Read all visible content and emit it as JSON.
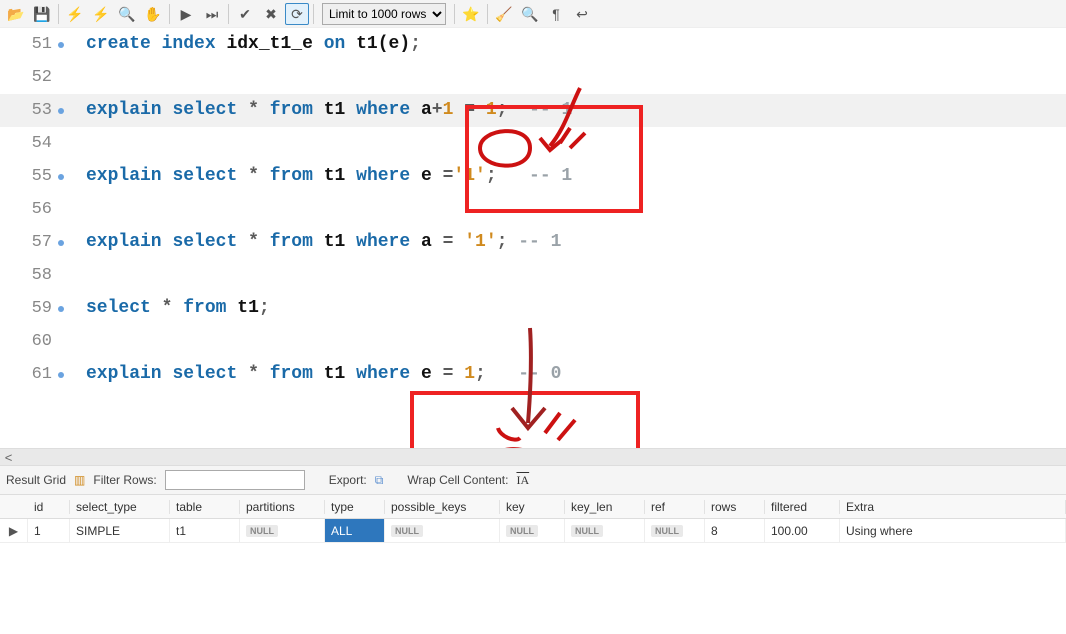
{
  "toolbar": {
    "limit_label": "Limit to 1000 rows",
    "icons": [
      "open-file-icon",
      "save-icon",
      "sep",
      "execute-icon",
      "execute-script-icon",
      "explain-icon",
      "stop-icon",
      "sep",
      "continue-icon",
      "skip-icon",
      "sep",
      "commit-icon",
      "rollback-icon",
      "autocommit-icon",
      "sep",
      "limit",
      "sep",
      "favorite-icon",
      "sep",
      "beautify-icon",
      "search-icon",
      "show-invisible-icon",
      "wrap-icon"
    ]
  },
  "editor": {
    "rows": [
      {
        "n": "51",
        "dot": true,
        "hl": false,
        "tokens": [
          [
            "kw",
            "create"
          ],
          [
            "sp",
            " "
          ],
          [
            "kw",
            "index"
          ],
          [
            "sp",
            " "
          ],
          [
            "id",
            "idx_t1_e"
          ],
          [
            "sp",
            " "
          ],
          [
            "kw",
            "on"
          ],
          [
            "sp",
            " "
          ],
          [
            "id",
            "t1(e)"
          ],
          [
            "op",
            ";"
          ]
        ]
      },
      {
        "n": "52",
        "dot": false,
        "hl": false,
        "tokens": []
      },
      {
        "n": "53",
        "dot": true,
        "hl": true,
        "tokens": [
          [
            "kw",
            "explain"
          ],
          [
            "sp",
            " "
          ],
          [
            "kw",
            "select"
          ],
          [
            "sp",
            " "
          ],
          [
            "op",
            "*"
          ],
          [
            "sp",
            " "
          ],
          [
            "kw",
            "from"
          ],
          [
            "sp",
            " "
          ],
          [
            "id",
            "t1"
          ],
          [
            "sp",
            " "
          ],
          [
            "kw",
            "where"
          ],
          [
            "sp",
            " "
          ],
          [
            "id",
            "a"
          ],
          [
            "op",
            "+"
          ],
          [
            "num",
            "1"
          ],
          [
            "sp",
            " "
          ],
          [
            "op",
            "="
          ],
          [
            "sp",
            " "
          ],
          [
            "num",
            "1"
          ],
          [
            "op",
            ";"
          ],
          [
            "sp",
            "  "
          ],
          [
            "cm",
            "-- 1"
          ]
        ]
      },
      {
        "n": "54",
        "dot": false,
        "hl": false,
        "tokens": []
      },
      {
        "n": "55",
        "dot": true,
        "hl": false,
        "tokens": [
          [
            "kw",
            "explain"
          ],
          [
            "sp",
            " "
          ],
          [
            "kw",
            "select"
          ],
          [
            "sp",
            " "
          ],
          [
            "op",
            "*"
          ],
          [
            "sp",
            " "
          ],
          [
            "kw",
            "from"
          ],
          [
            "sp",
            " "
          ],
          [
            "id",
            "t1"
          ],
          [
            "sp",
            " "
          ],
          [
            "kw",
            "where"
          ],
          [
            "sp",
            " "
          ],
          [
            "id",
            "e"
          ],
          [
            "sp",
            " "
          ],
          [
            "op",
            "="
          ],
          [
            "str",
            "'1'"
          ],
          [
            "op",
            ";"
          ],
          [
            "sp",
            "   "
          ],
          [
            "cm",
            "-- 1"
          ]
        ]
      },
      {
        "n": "56",
        "dot": false,
        "hl": false,
        "tokens": []
      },
      {
        "n": "57",
        "dot": true,
        "hl": false,
        "tokens": [
          [
            "kw",
            "explain"
          ],
          [
            "sp",
            " "
          ],
          [
            "kw",
            "select"
          ],
          [
            "sp",
            " "
          ],
          [
            "op",
            "*"
          ],
          [
            "sp",
            " "
          ],
          [
            "kw",
            "from"
          ],
          [
            "sp",
            " "
          ],
          [
            "id",
            "t1"
          ],
          [
            "sp",
            " "
          ],
          [
            "kw",
            "where"
          ],
          [
            "sp",
            " "
          ],
          [
            "id",
            "a"
          ],
          [
            "sp",
            " "
          ],
          [
            "op",
            "="
          ],
          [
            "sp",
            " "
          ],
          [
            "str",
            "'1'"
          ],
          [
            "op",
            ";"
          ],
          [
            "sp",
            " "
          ],
          [
            "cm",
            "-- 1"
          ]
        ]
      },
      {
        "n": "58",
        "dot": false,
        "hl": false,
        "tokens": []
      },
      {
        "n": "59",
        "dot": true,
        "hl": false,
        "tokens": [
          [
            "kw",
            "select"
          ],
          [
            "sp",
            " "
          ],
          [
            "op",
            "*"
          ],
          [
            "sp",
            " "
          ],
          [
            "kw",
            "from"
          ],
          [
            "sp",
            " "
          ],
          [
            "id",
            "t1"
          ],
          [
            "op",
            ";"
          ]
        ]
      },
      {
        "n": "60",
        "dot": false,
        "hl": false,
        "tokens": []
      },
      {
        "n": "61",
        "dot": true,
        "hl": false,
        "tokens": [
          [
            "kw",
            "explain"
          ],
          [
            "sp",
            " "
          ],
          [
            "kw",
            "select"
          ],
          [
            "sp",
            " "
          ],
          [
            "op",
            "*"
          ],
          [
            "sp",
            " "
          ],
          [
            "kw",
            "from"
          ],
          [
            "sp",
            " "
          ],
          [
            "id",
            "t1"
          ],
          [
            "sp",
            " "
          ],
          [
            "kw",
            "where"
          ],
          [
            "sp",
            " "
          ],
          [
            "id",
            "e"
          ],
          [
            "sp",
            " "
          ],
          [
            "op",
            "="
          ],
          [
            "sp",
            " "
          ],
          [
            "num",
            "1"
          ],
          [
            "op",
            ";"
          ],
          [
            "sp",
            "   "
          ],
          [
            "cm",
            "-- 0"
          ]
        ]
      }
    ]
  },
  "hscroll_left": "<",
  "result_bar": {
    "result_grid": "Result Grid",
    "filter_label": "Filter Rows:",
    "filter_value": "",
    "export_label": "Export:",
    "wrap_label": "Wrap Cell Content:"
  },
  "grid": {
    "headers": [
      "",
      "id",
      "select_type",
      "table",
      "partitions",
      "type",
      "possible_keys",
      "key",
      "key_len",
      "ref",
      "rows",
      "filtered",
      "Extra"
    ],
    "row": {
      "marker": "▶",
      "id": "1",
      "select_type": "SIMPLE",
      "table": "t1",
      "partitions": "NULL",
      "type": "ALL",
      "possible_keys": "NULL",
      "key": "NULL",
      "key_len": "NULL",
      "ref": "NULL",
      "rows": "8",
      "filtered": "100.00",
      "extra": "Using where"
    }
  }
}
